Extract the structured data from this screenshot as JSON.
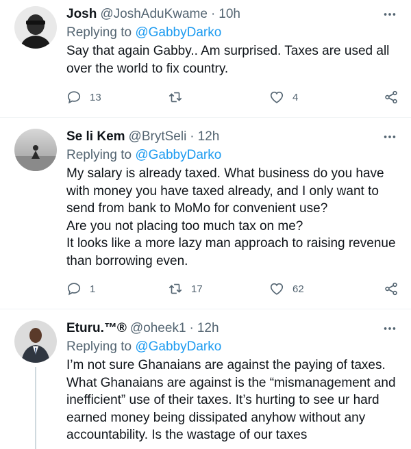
{
  "tweets": [
    {
      "name": "Josh",
      "handle": "@JoshAduKwame",
      "dot": "·",
      "time": "10h",
      "reply_prefix": "Replying to",
      "reply_to": "@GabbyDarko",
      "lines": [
        "Say that again Gabby.. Am surprised. Taxes are used all",
        "over the world to fix country."
      ],
      "replies": "13",
      "retweets": "",
      "likes": "4"
    },
    {
      "name": "Se li Kem",
      "handle": "@BrytSeli",
      "dot": "·",
      "time": "12h",
      "reply_prefix": "Replying to",
      "reply_to": "@GabbyDarko",
      "lines": [
        "My salary is already taxed. What business do you have",
        "with money you have taxed already, and I only want to",
        "send from bank to MoMo for convenient use?",
        "Are you not placing too much tax on me?",
        "It looks like a more lazy man approach to raising revenue",
        "than borrowing even."
      ],
      "replies": "1",
      "retweets": "17",
      "likes": "62"
    },
    {
      "name": "Eturu.™®",
      "handle": "@oheek1",
      "dot": "·",
      "time": "12h",
      "reply_prefix": "Replying to",
      "reply_to": "@GabbyDarko",
      "lines": [
        "I’m not sure Ghanaians are against the paying of taxes.",
        "What Ghanaians are against is the “mismanagement and",
        "inefficient” use of their taxes. It’s hurting to see ur hard",
        "earned money being dissipated anyhow without any",
        "accountability. Is the wastage of our taxes"
      ]
    }
  ],
  "colors": {
    "accent": "#1d9bf0",
    "secondary": "#536471",
    "divider": "#eff3f4",
    "text": "#0f1419"
  },
  "icons": [
    "more-icon",
    "reply-icon",
    "retweet-icon",
    "like-icon",
    "share-icon"
  ]
}
